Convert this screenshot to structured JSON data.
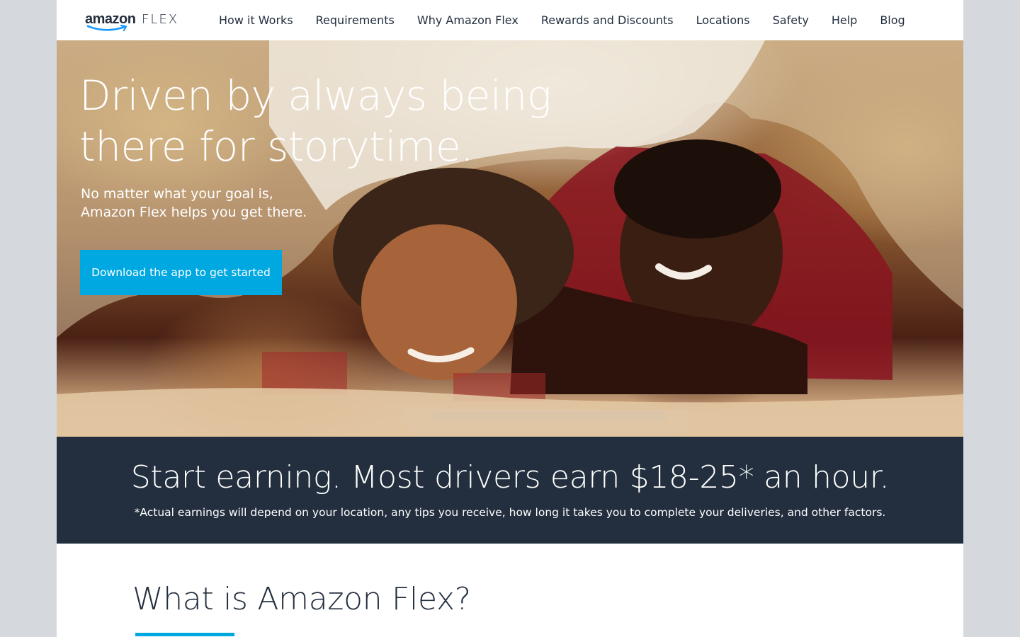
{
  "brand": {
    "name_amazon": "amazon",
    "name_flex": "FLEX"
  },
  "nav": {
    "items": [
      {
        "label": "How it Works"
      },
      {
        "label": "Requirements"
      },
      {
        "label": "Why Amazon Flex"
      },
      {
        "label": "Rewards and Discounts"
      },
      {
        "label": "Locations"
      },
      {
        "label": "Safety"
      },
      {
        "label": "Help"
      },
      {
        "label": "Blog"
      }
    ]
  },
  "hero": {
    "title_line1": "Driven by always being",
    "title_line2": "there for storytime.",
    "subtitle_line1": "No matter what your goal is,",
    "subtitle_line2": "Amazon Flex helps you get there.",
    "cta_label": "Download the app to get started"
  },
  "earnings": {
    "headline": "Start earning. Most drivers earn $18-25* an hour.",
    "disclaimer": "*Actual earnings will depend on your location, any tips you receive, how long it takes you to complete your deliveries, and other factors."
  },
  "what_is": {
    "heading": "What is Amazon Flex?"
  },
  "colors": {
    "navy": "#232f3e",
    "accent_blue": "#00a8e1",
    "page_bg": "#d5d9de"
  }
}
